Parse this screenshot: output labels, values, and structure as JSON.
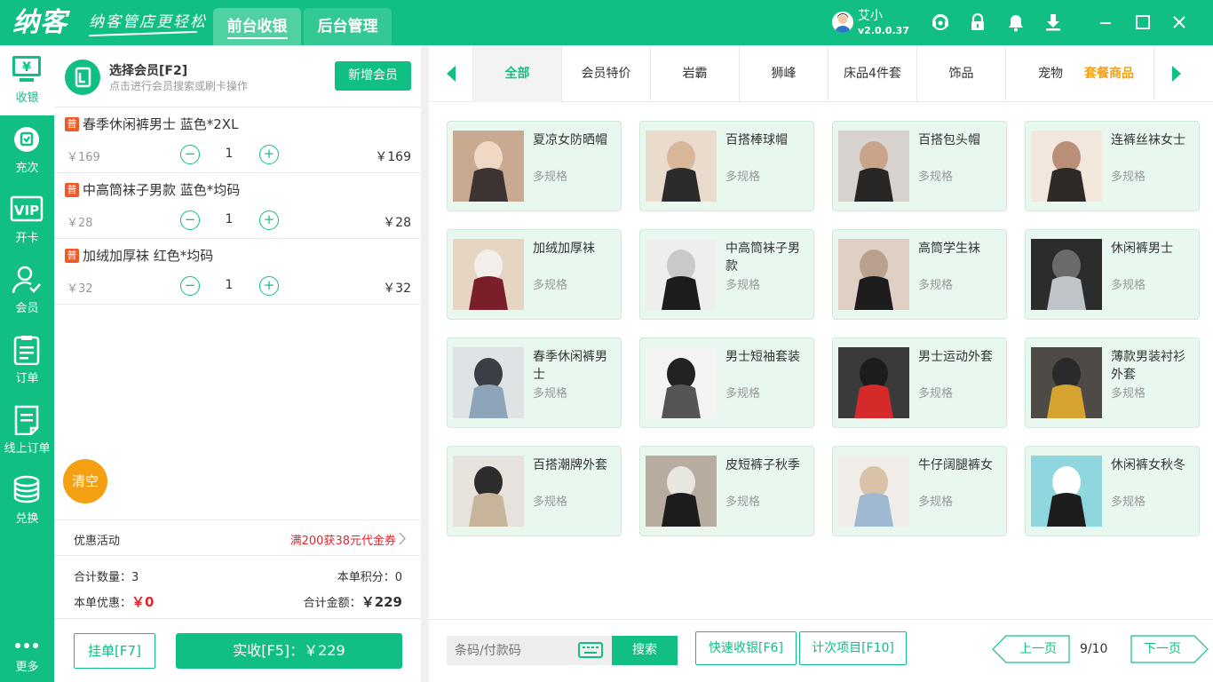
{
  "header": {
    "logo": "纳客",
    "slogan": "纳客管店更轻松",
    "tabs": [
      {
        "label": "前台收银"
      },
      {
        "label": "后台管理"
      }
    ],
    "user": {
      "name": "艾小",
      "version": "v2.0.0.37"
    }
  },
  "sidebar": {
    "items": [
      {
        "label": "收银"
      },
      {
        "label": "充次"
      },
      {
        "label": "开卡"
      },
      {
        "label": "会员"
      },
      {
        "label": "订单"
      },
      {
        "label": "线上订单"
      },
      {
        "label": "兑换"
      },
      {
        "label": "更多"
      }
    ]
  },
  "member": {
    "title": "选择会员[F2]",
    "subtitle": "点击进行会员搜索或刷卡操作",
    "add_button": "新增会员"
  },
  "cart": {
    "tag": "普",
    "items": [
      {
        "name": "春季休闲裤男士 蓝色*2XL",
        "price": "￥169",
        "qty": "1",
        "total": "￥169"
      },
      {
        "name": "中高筒袜子男款 蓝色*均码",
        "price": "￥28",
        "qty": "1",
        "total": "￥28"
      },
      {
        "name": "加绒加厚袜 红色*均码",
        "price": "￥32",
        "qty": "1",
        "total": "￥32"
      }
    ],
    "clear_button": "清空"
  },
  "promo": {
    "label": "优惠活动",
    "value": "满200获38元代金券"
  },
  "summary": {
    "count_label": "合计数量：",
    "count": "3",
    "points_label": "本单积分：",
    "points": "0",
    "discount_label": "本单优惠：",
    "discount": "￥0",
    "total_label": "合计金额：",
    "total": "￥229"
  },
  "actions": {
    "hold": "挂单[F7]",
    "pay": "实收[F5]：￥229"
  },
  "categories": {
    "items": [
      "全部",
      "会员特价",
      "岩霸",
      "狮峰",
      "床品4件套",
      "饰品",
      "宠物"
    ],
    "extra": "套餐商品"
  },
  "products": [
    {
      "name": "夏凉女防晒帽",
      "spec": "多规格"
    },
    {
      "name": "百搭棒球帽",
      "spec": "多规格"
    },
    {
      "name": "百搭包头帽",
      "spec": "多规格"
    },
    {
      "name": "连裤丝袜女士",
      "spec": "多规格"
    },
    {
      "name": "加绒加厚袜",
      "spec": "多规格"
    },
    {
      "name": "中高筒袜子男款",
      "spec": "多规格"
    },
    {
      "name": "高筒学生袜",
      "spec": "多规格"
    },
    {
      "name": "休闲裤男士",
      "spec": "多规格"
    },
    {
      "name": "春季休闲裤男士",
      "spec": "多规格"
    },
    {
      "name": "男士短袖套装",
      "spec": "多规格"
    },
    {
      "name": "男士运动外套",
      "spec": "多规格"
    },
    {
      "name": "薄款男装衬衫外套",
      "spec": "多规格"
    },
    {
      "name": "百搭潮牌外套",
      "spec": "多规格"
    },
    {
      "name": "皮短裤子秋季",
      "spec": "多规格"
    },
    {
      "name": "牛仔阔腿裤女",
      "spec": "多规格"
    },
    {
      "name": "休闲裤女秋冬",
      "spec": "多规格"
    }
  ],
  "bottom": {
    "scan_placeholder": "条码/付款码",
    "search": "搜索",
    "quick_pay": "快速收银[F6]",
    "count_items": "计次项目[F10]",
    "prev": "上一页",
    "page": "9/10",
    "next": "下一页"
  },
  "colors": {
    "accent": "#11bf82",
    "warning": "#f5a013",
    "price_red": "#e5262e",
    "card_bg": "#e9f8ef"
  }
}
